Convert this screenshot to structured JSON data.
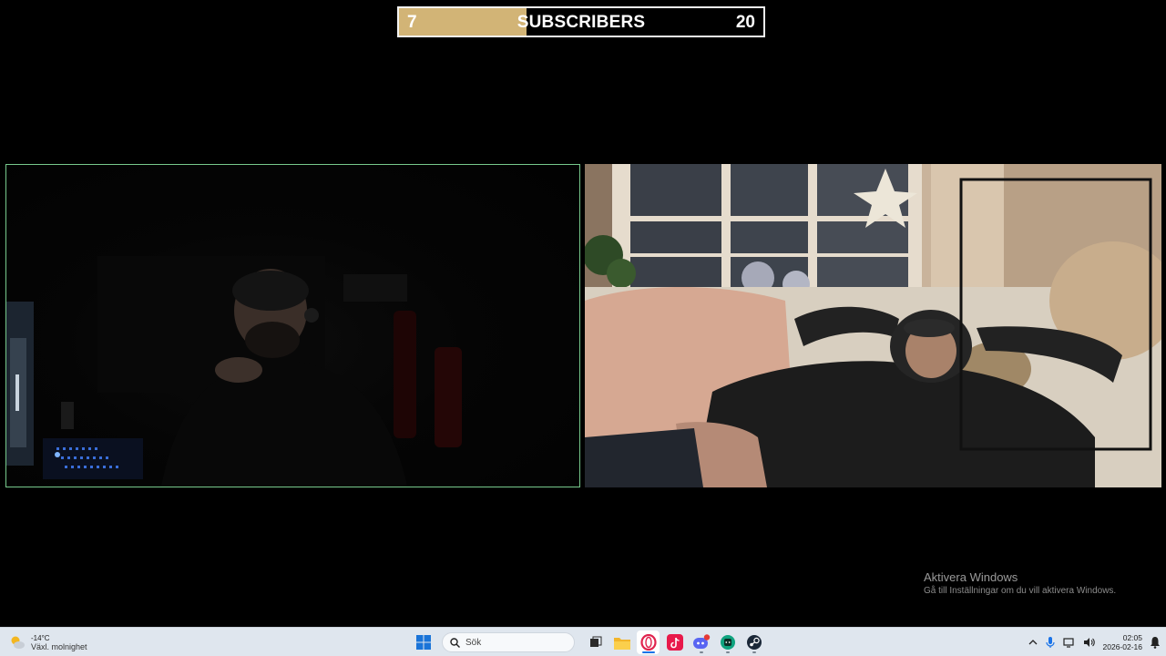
{
  "overlay": {
    "goal_current": "7",
    "goal_label": "SUBSCRIBERS",
    "goal_target": "20",
    "goal_progress_fraction": 0.35,
    "fill_color": "#d2b476"
  },
  "webcams": {
    "left_border_color": "#77c98c"
  },
  "watermark": {
    "title": "Aktivera Windows",
    "subtitle": "Gå till Inställningar om du vill aktivera Windows."
  },
  "taskbar": {
    "weather_temp": "-14°C",
    "weather_desc": "Växl. molnighet",
    "search_placeholder": "Sök",
    "pinned_icons": [
      "windows-start-icon",
      "task-view-icon",
      "file-explorer-icon",
      "opera-gx-icon",
      "tiktok-icon",
      "discord-icon",
      "chatgpt-icon",
      "steam-icon"
    ],
    "clock_time": "02:05",
    "clock_date": "2026-02-16"
  }
}
